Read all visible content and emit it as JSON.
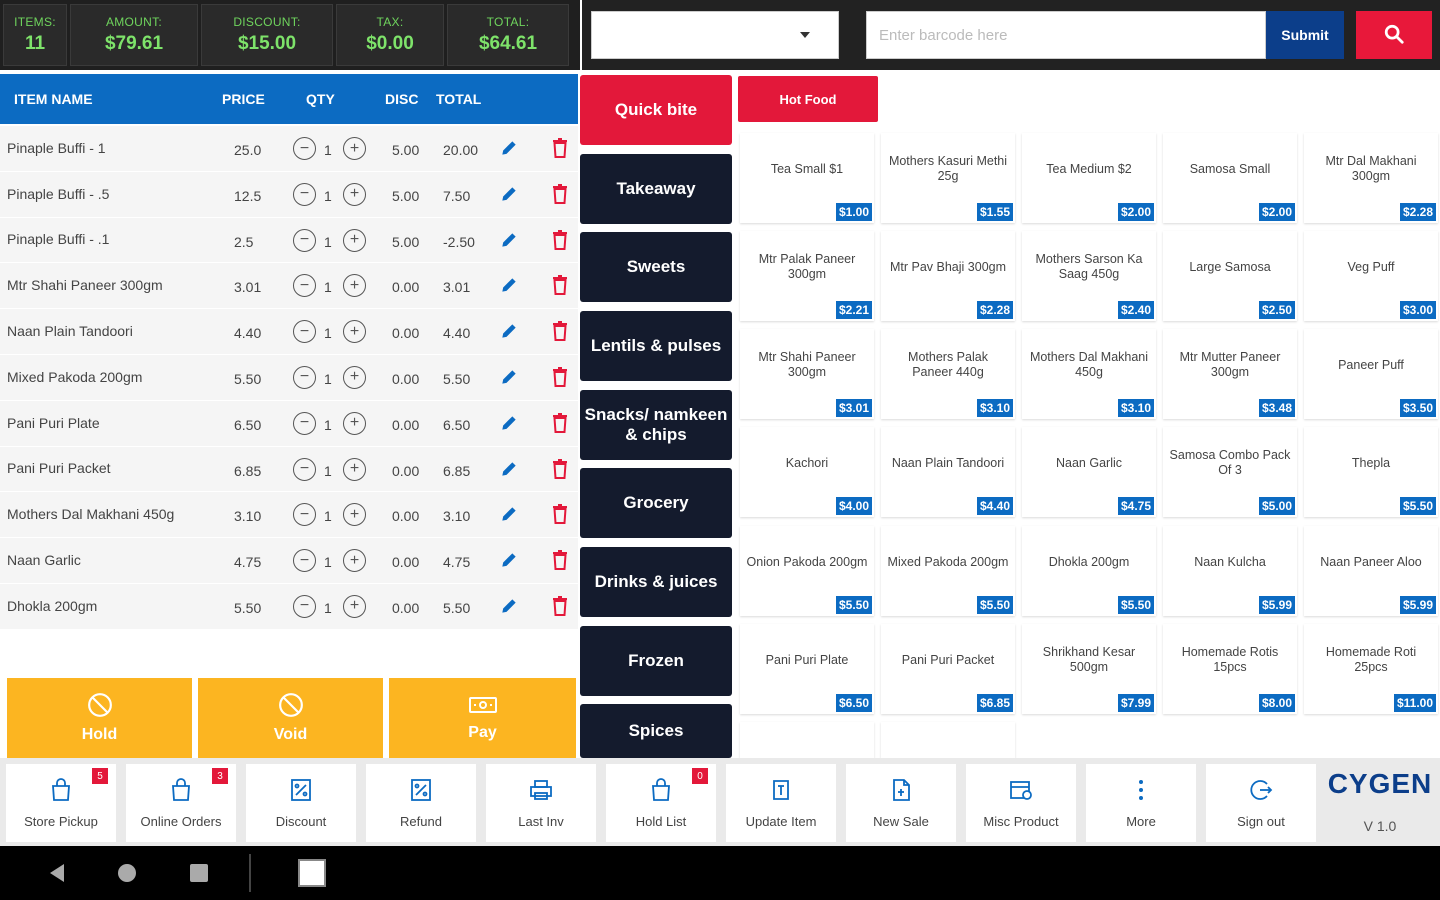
{
  "summary": {
    "items": {
      "label": "ITEMS:",
      "value": "11"
    },
    "amount": {
      "label": "AMOUNT:",
      "value": "$79.61"
    },
    "discount": {
      "label": "DISCOUNT:",
      "value": "$15.00"
    },
    "tax": {
      "label": "TAX:",
      "value": "$0.00"
    },
    "total": {
      "label": "TOTAL:",
      "value": "$64.61"
    }
  },
  "search": {
    "barcode_placeholder": "Enter barcode here",
    "submit_label": "Submit"
  },
  "cart": {
    "headers": {
      "name": "ITEM NAME",
      "price": "PRICE",
      "qty": "QTY",
      "disc": "DISC",
      "total": "TOTAL"
    },
    "rows": [
      {
        "name": "Pinaple Buffi - 1",
        "price": "25.0",
        "qty": "1",
        "disc": "5.00",
        "total": "20.00"
      },
      {
        "name": "Pinaple Buffi - .5",
        "price": "12.5",
        "qty": "1",
        "disc": "5.00",
        "total": "7.50"
      },
      {
        "name": "Pinaple Buffi - .1",
        "price": "2.5",
        "qty": "1",
        "disc": "5.00",
        "total": "-2.50"
      },
      {
        "name": "Mtr Shahi Paneer 300gm",
        "price": "3.01",
        "qty": "1",
        "disc": "0.00",
        "total": "3.01"
      },
      {
        "name": "Naan Plain Tandoori",
        "price": "4.40",
        "qty": "1",
        "disc": "0.00",
        "total": "4.40"
      },
      {
        "name": "Mixed Pakoda 200gm",
        "price": "5.50",
        "qty": "1",
        "disc": "0.00",
        "total": "5.50"
      },
      {
        "name": "Pani Puri Plate",
        "price": "6.50",
        "qty": "1",
        "disc": "0.00",
        "total": "6.50"
      },
      {
        "name": "Pani Puri Packet",
        "price": "6.85",
        "qty": "1",
        "disc": "0.00",
        "total": "6.85"
      },
      {
        "name": "Mothers Dal Makhani 450g",
        "price": "3.10",
        "qty": "1",
        "disc": "0.00",
        "total": "3.10"
      },
      {
        "name": "Naan Garlic",
        "price": "4.75",
        "qty": "1",
        "disc": "0.00",
        "total": "4.75"
      },
      {
        "name": "Dhokla 200gm",
        "price": "5.50",
        "qty": "1",
        "disc": "0.00",
        "total": "5.50"
      }
    ]
  },
  "actions": {
    "hold": "Hold",
    "void": "Void",
    "pay": "Pay"
  },
  "categories": [
    {
      "label": "Quick bite",
      "active": true
    },
    {
      "label": "Takeaway"
    },
    {
      "label": "Sweets"
    },
    {
      "label": "Lentils & pulses"
    },
    {
      "label": "Snacks/ namkeen & chips"
    },
    {
      "label": "Grocery"
    },
    {
      "label": "Drinks & juices"
    },
    {
      "label": "Frozen"
    },
    {
      "label": "Spices"
    }
  ],
  "subcategory": {
    "label": "Hot Food"
  },
  "products": [
    {
      "name": "Tea Small $1",
      "price": "$1.00"
    },
    {
      "name": "Mothers Kasuri Methi 25g",
      "price": "$1.55"
    },
    {
      "name": "Tea Medium $2",
      "price": "$2.00"
    },
    {
      "name": "Samosa Small",
      "price": "$2.00"
    },
    {
      "name": "Mtr Dal Makhani 300gm",
      "price": "$2.28"
    },
    {
      "name": "Mtr Palak Paneer 300gm",
      "price": "$2.21"
    },
    {
      "name": "Mtr Pav Bhaji 300gm",
      "price": "$2.28"
    },
    {
      "name": "Mothers Sarson Ka Saag 450g",
      "price": "$2.40"
    },
    {
      "name": "Large Samosa",
      "price": "$2.50"
    },
    {
      "name": "Veg Puff",
      "price": "$3.00"
    },
    {
      "name": "Mtr Shahi Paneer 300gm",
      "price": "$3.01"
    },
    {
      "name": "Mothers Palak Paneer 440g",
      "price": "$3.10"
    },
    {
      "name": "Mothers Dal Makhani 450g",
      "price": "$3.10"
    },
    {
      "name": "Mtr Mutter Paneer 300gm",
      "price": "$3.48"
    },
    {
      "name": "Paneer Puff",
      "price": "$3.50"
    },
    {
      "name": "Kachori",
      "price": "$4.00"
    },
    {
      "name": "Naan Plain Tandoori",
      "price": "$4.40"
    },
    {
      "name": "Naan Garlic",
      "price": "$4.75"
    },
    {
      "name": "Samosa Combo Pack Of 3",
      "price": "$5.00"
    },
    {
      "name": "Thepla",
      "price": "$5.50"
    },
    {
      "name": "Onion Pakoda 200gm",
      "price": "$5.50"
    },
    {
      "name": "Mixed Pakoda 200gm",
      "price": "$5.50"
    },
    {
      "name": "Dhokla 200gm",
      "price": "$5.50"
    },
    {
      "name": "Naan Kulcha",
      "price": "$5.99"
    },
    {
      "name": "Naan Paneer Aloo",
      "price": "$5.99"
    },
    {
      "name": "Pani Puri Plate",
      "price": "$6.50"
    },
    {
      "name": "Pani Puri Packet",
      "price": "$6.85"
    },
    {
      "name": "Shrikhand Kesar 500gm",
      "price": "$7.99"
    },
    {
      "name": "Homemade Rotis 15pcs",
      "price": "$8.00"
    },
    {
      "name": "Homemade Roti 25pcs",
      "price": "$11.00"
    }
  ],
  "toolbar": {
    "store_pickup": {
      "label": "Store Pickup",
      "badge": "5"
    },
    "online_orders": {
      "label": "Online Orders",
      "badge": "3"
    },
    "discount": {
      "label": "Discount"
    },
    "refund": {
      "label": "Refund"
    },
    "last_inv": {
      "label": "Last Inv"
    },
    "hold_list": {
      "label": "Hold List",
      "badge": "0"
    },
    "update_item": {
      "label": "Update Item"
    },
    "new_sale": {
      "label": "New Sale"
    },
    "misc_product": {
      "label": "Misc Product"
    },
    "more": {
      "label": "More"
    },
    "sign_out": {
      "label": "Sign out"
    }
  },
  "brand": {
    "logo": "CYGEN",
    "version": "V 1.0"
  },
  "colors": {
    "primary_blue": "#0c6bc2",
    "accent_red": "#e3183a",
    "dark_navy": "#141b2d",
    "action_yellow": "#fcb521",
    "summary_green": "#7ee36a"
  }
}
